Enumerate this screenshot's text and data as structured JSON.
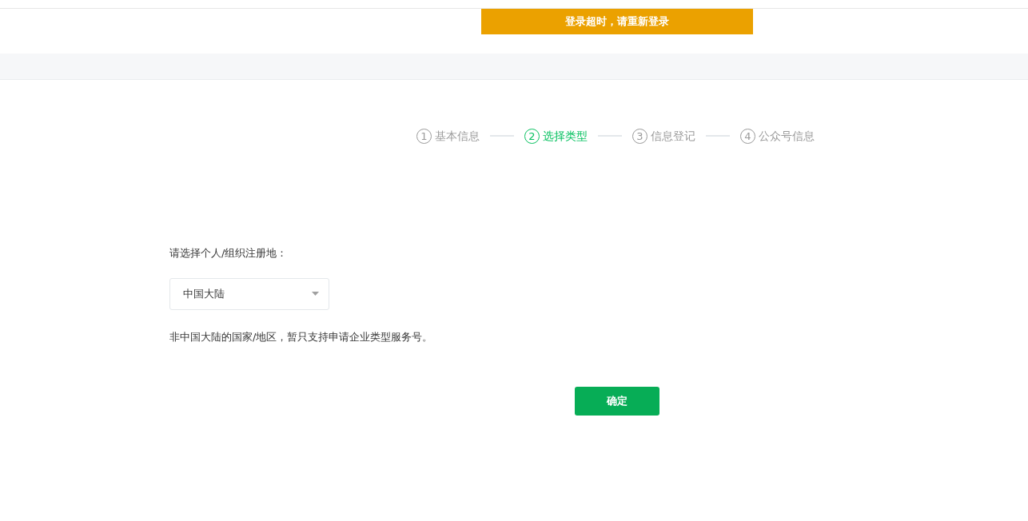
{
  "alert": {
    "text": "登录超时，请重新登录"
  },
  "steps": [
    {
      "number": "1",
      "label": "基本信息",
      "selected": false
    },
    {
      "number": "2",
      "label": "选择类型",
      "selected": true
    },
    {
      "number": "3",
      "label": "信息登记",
      "selected": false
    },
    {
      "number": "4",
      "label": "公众号信息",
      "selected": false
    }
  ],
  "form": {
    "label": "请选择个人/组织注册地：",
    "select": {
      "value": "中国大陆"
    },
    "note": "非中国大陆的国家/地区，暂只支持申请企业类型服务号。",
    "button": "确定"
  }
}
